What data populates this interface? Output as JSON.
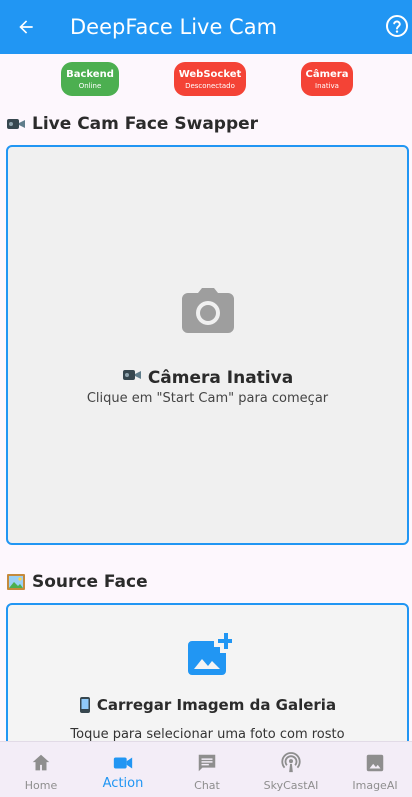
{
  "app_bar": {
    "title": "DeepFace Live Cam"
  },
  "status": [
    {
      "title": "Backend",
      "subtitle": "Online",
      "color": "#4caf50"
    },
    {
      "title": "WebSocket",
      "subtitle": "Desconectado",
      "color": "#f44336"
    },
    {
      "title": "Câmera",
      "subtitle": "Inativa",
      "color": "#f44336"
    }
  ],
  "live_cam": {
    "section_title": "Live Cam Face Swapper",
    "state_title": "Câmera Inativa",
    "hint": "Clique em \"Start Cam\" para começar"
  },
  "source_face": {
    "section_title": "Source Face",
    "upload_title": "Carregar Imagem da Galeria",
    "hint": "Toque para selecionar uma foto com rosto"
  },
  "bottom_nav": [
    {
      "label": "Home",
      "icon": "home-icon",
      "active": false
    },
    {
      "label": "Action",
      "icon": "videocam-icon",
      "active": true
    },
    {
      "label": "Chat",
      "icon": "chat-icon",
      "active": false
    },
    {
      "label": "SkyCastAI",
      "icon": "podcast-icon",
      "active": false
    },
    {
      "label": "ImageAI",
      "icon": "image-icon",
      "active": false
    }
  ],
  "colors": {
    "primary": "#2196f3",
    "online": "#4caf50",
    "offline": "#f44336"
  }
}
